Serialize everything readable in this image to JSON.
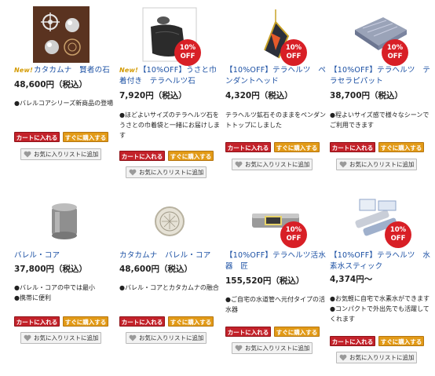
{
  "products": [
    {
      "new": "New!",
      "name": "カタカムナ　賢者の石",
      "price": "48,600円（税込）",
      "desc": "●バレルコアシリーズ新商品の登場",
      "cart": "カートに入れる",
      "buy": "すぐに購入する",
      "fav": "お気に入りリストに追加"
    },
    {
      "new": "New!",
      "name": "【10%OFF】うさと巾着付き　テラヘルツ石",
      "price": "7,920円（税込）",
      "desc": "●ほどよいサイズのテラヘルツ石をうさとの巾着袋と一緒にお届けします",
      "cart": "カートに入れる",
      "buy": "すぐに購入する",
      "fav": "お気に入りリストに追加",
      "badge": "10% OFF"
    },
    {
      "name": "【10%OFF】テラヘルツ　ペンダントヘッド",
      "price": "4,320円（税込）",
      "desc": "テラヘルツ鉱石そのままをペンダントトップにしました",
      "cart": "カートに入れる",
      "buy": "すぐに購入する",
      "fav": "お気に入りリストに追加",
      "badge": "10% OFF"
    },
    {
      "name": "【10%OFF】テラヘルツ　テラセラピパット",
      "price": "38,700円（税込）",
      "desc": "●程よいサイズ感で様々なシーンでご利用できます",
      "cart": "カートに入れる",
      "buy": "すぐに購入する",
      "fav": "お気に入りリストに追加",
      "badge": "10% OFF"
    },
    {
      "name": "バレル・コア",
      "price": "37,800円（税込）",
      "desc": "●バレル・コアの中では最小\n●携帯に便利",
      "cart": "カートに入れる",
      "buy": "すぐに購入する",
      "fav": "お気に入りリストに追加"
    },
    {
      "name": "カタカムナ　バレル・コア",
      "price": "48,600円（税込）",
      "desc": "●バレル・コアとカタカムナの融合",
      "cart": "カートに入れる",
      "buy": "すぐに購入する",
      "fav": "お気に入りリストに追加"
    },
    {
      "name": "【10%OFF】テラヘルツ活水器　匠",
      "price": "155,520円（税込）",
      "desc": "●ご自宅の水道管へ元付タイプの活水器",
      "cart": "カートに入れる",
      "buy": "すぐに購入する",
      "fav": "お気に入りリストに追加",
      "badge": "10% OFF"
    },
    {
      "name": "【10%OFF】テラヘルツ　水素水スティック",
      "price": "4,374円〜",
      "desc": "●お気軽に自宅で水素水ができます\n●コンパクトで外出先でも活躍してくれます",
      "cart": "カートに入れる",
      "buy": "すぐに購入する",
      "fav": "お気に入りリストに追加",
      "badge": "10% OFF"
    }
  ]
}
